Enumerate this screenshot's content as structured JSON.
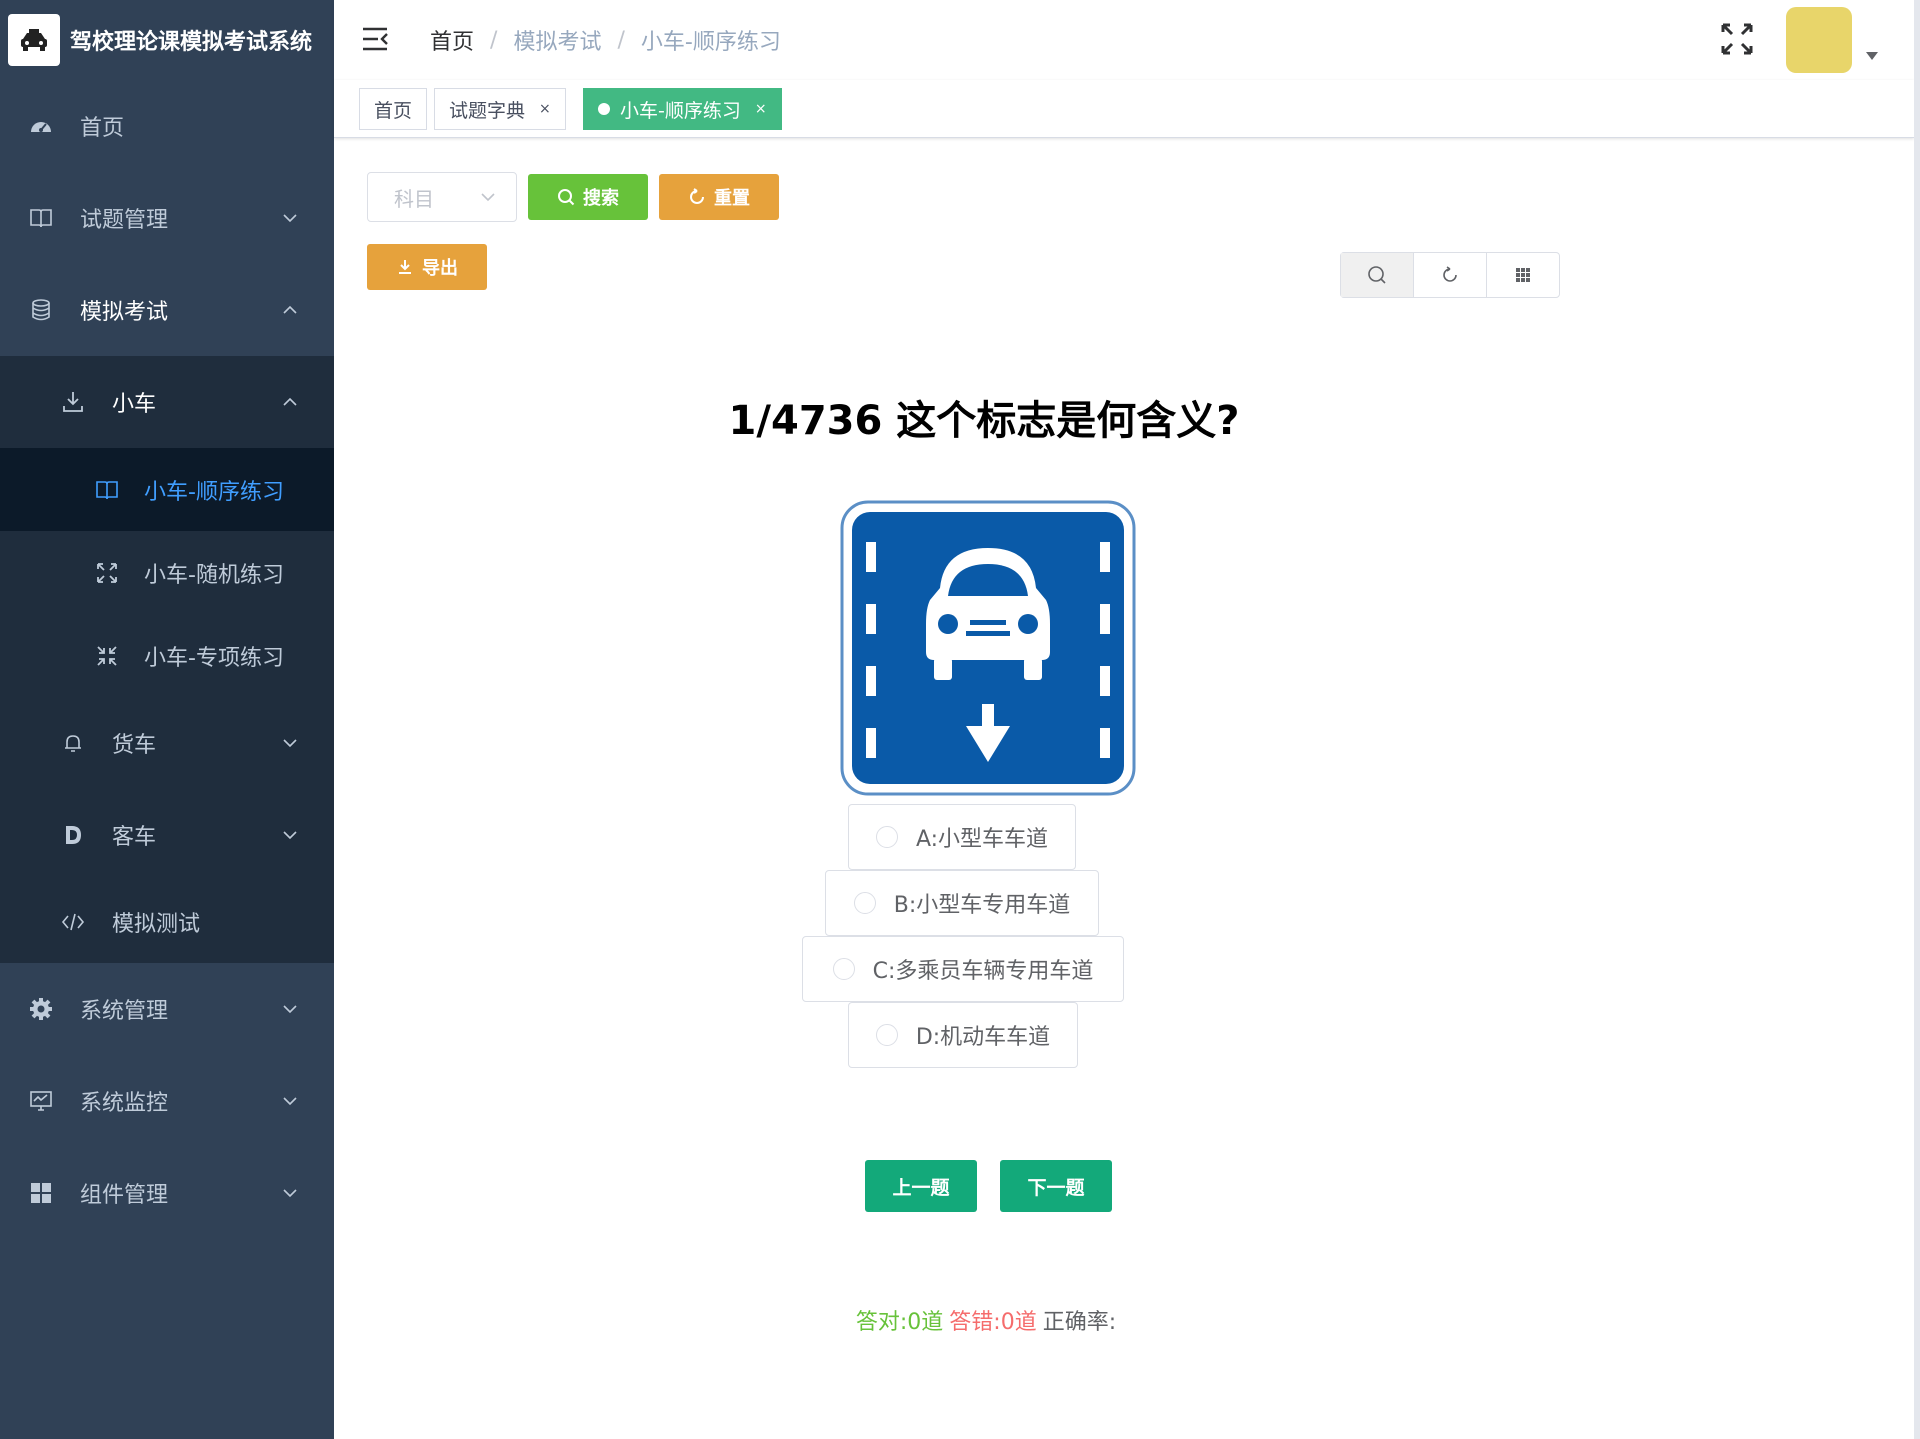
{
  "app": {
    "title": "驾校理论课模拟考试系统",
    "logo_icon": "car-icon"
  },
  "sidebar": {
    "items": [
      {
        "label": "首页",
        "icon": "dashboard-icon"
      },
      {
        "label": "试题管理",
        "icon": "book-icon"
      },
      {
        "label": "模拟考试",
        "icon": "database-icon"
      },
      {
        "label": "小车",
        "icon": "download-icon"
      },
      {
        "label": "小车-顺序练习",
        "icon": "book-icon"
      },
      {
        "label": "小车-随机练习",
        "icon": "expand-icon"
      },
      {
        "label": "小车-专项练习",
        "icon": "compress-icon"
      },
      {
        "label": "货车",
        "icon": "bell-icon"
      },
      {
        "label": "客车",
        "icon": "d-letter-icon"
      },
      {
        "label": "模拟测试",
        "icon": "code-icon"
      },
      {
        "label": "系统管理",
        "icon": "gear-icon"
      },
      {
        "label": "系统监控",
        "icon": "monitor-icon"
      },
      {
        "label": "组件管理",
        "icon": "grid-icon"
      }
    ],
    "active_color": "#409eff"
  },
  "header": {
    "breadcrumb": [
      "首页",
      "模拟考试",
      "小车-顺序练习"
    ],
    "breadcrumb_sep": "/"
  },
  "tags": [
    {
      "label": "首页",
      "closable": false
    },
    {
      "label": "试题字典",
      "closable": true
    },
    {
      "label": "小车-顺序练习",
      "closable": true,
      "active": true
    }
  ],
  "tag_close_glyph": "×",
  "filters": {
    "subject_placeholder": "科目",
    "search_label": "搜索",
    "reset_label": "重置",
    "export_label": "导出"
  },
  "question": {
    "text": "1/4736 这个标志是何含义?",
    "image_icon": "small-vehicle-lane-sign",
    "options": [
      {
        "label": "A:小型车车道"
      },
      {
        "label": "B:小型车专用车道"
      },
      {
        "label": "C:多乘员车辆专用车道"
      },
      {
        "label": "D:机动车车道"
      }
    ]
  },
  "nav": {
    "prev_label": "上一题",
    "next_label": "下一题"
  },
  "stats": {
    "correct": "答对:0道",
    "wrong": "答错:0道",
    "rate": "正确率:"
  },
  "colors": {
    "sidebar_bg": "#304156",
    "success": "#67c23a",
    "warning": "#e6a23c",
    "tag_active": "#42b983",
    "nav_button": "#13a97a",
    "danger": "#f56c6c",
    "sign_blue": "#0a5aa8"
  }
}
